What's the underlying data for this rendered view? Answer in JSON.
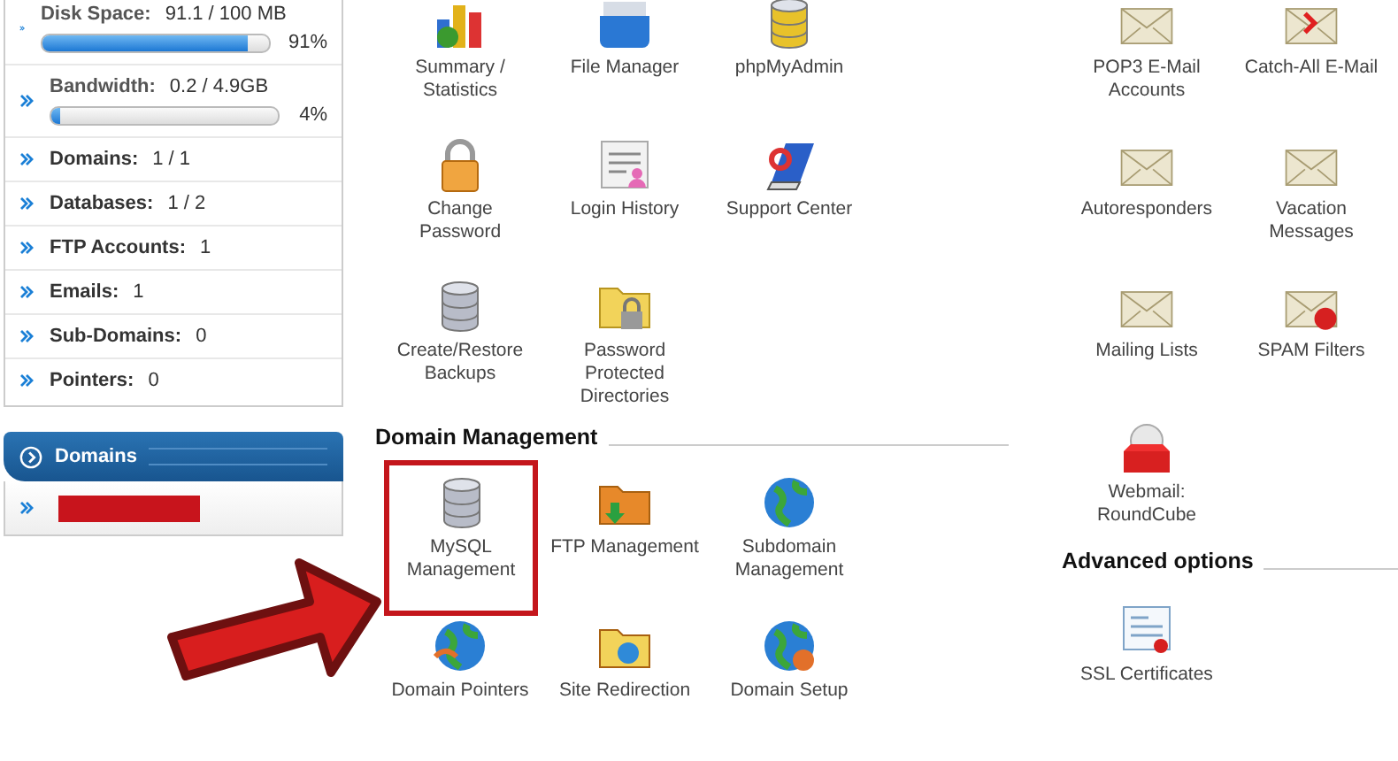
{
  "sidebar": {
    "stats": [
      {
        "kind": "meter",
        "label": "Disk Space:",
        "value": "91.1 / 100 MB",
        "level": 0.91,
        "percent": "91%"
      },
      {
        "kind": "meter",
        "label": "Bandwidth:",
        "value": "0.2 / 4.9GB",
        "level": 0.04,
        "percent": "4%"
      },
      {
        "kind": "count",
        "label": "Domains:",
        "value": "1 / 1"
      },
      {
        "kind": "count",
        "label": "Databases:",
        "value": "1 / 2"
      },
      {
        "kind": "count",
        "label": "FTP Accounts:",
        "value": "1"
      },
      {
        "kind": "count",
        "label": "Emails:",
        "value": "1"
      },
      {
        "kind": "count",
        "label": "Sub-Domains:",
        "value": "0"
      },
      {
        "kind": "count",
        "label": "Pointers:",
        "value": "0"
      }
    ],
    "domains_panel": {
      "title": "Domains"
    }
  },
  "left_column": [
    {
      "items": [
        {
          "label": "Summary /\nStatistics"
        },
        {
          "label": "File Manager"
        },
        {
          "label": "phpMyAdmin"
        },
        {
          "label": "Change\nPassword"
        },
        {
          "label": "Login History"
        },
        {
          "label": "Support Center"
        },
        {
          "label": "Create/Restore\nBackups"
        },
        {
          "label": "Password\nProtected\nDirectories"
        }
      ]
    },
    {
      "title": "Domain Management",
      "items": [
        {
          "label": "MySQL\nManagement",
          "highlighted": true
        },
        {
          "label": "FTP Management",
          "highlighted": false
        },
        {
          "label": "Subdomain\nManagement",
          "highlighted": false
        },
        {
          "label": "Domain Pointers",
          "highlighted": false
        },
        {
          "label": "Site Redirection",
          "highlighted": false
        },
        {
          "label": "Domain Setup",
          "highlighted": false
        }
      ]
    }
  ],
  "right_column": [
    {
      "items": [
        {
          "label": "POP3 E-Mail\nAccounts"
        },
        {
          "label": "Catch-All E-Mail"
        },
        {
          "label": "Autoresponders"
        },
        {
          "label": "Vacation\nMessages"
        },
        {
          "label": "Mailing Lists"
        },
        {
          "label": "SPAM Filters"
        },
        {
          "label": "Webmail:\nRoundCube"
        }
      ]
    },
    {
      "title": "Advanced options",
      "items": [
        {
          "label": "SSL Certificates"
        }
      ]
    }
  ]
}
